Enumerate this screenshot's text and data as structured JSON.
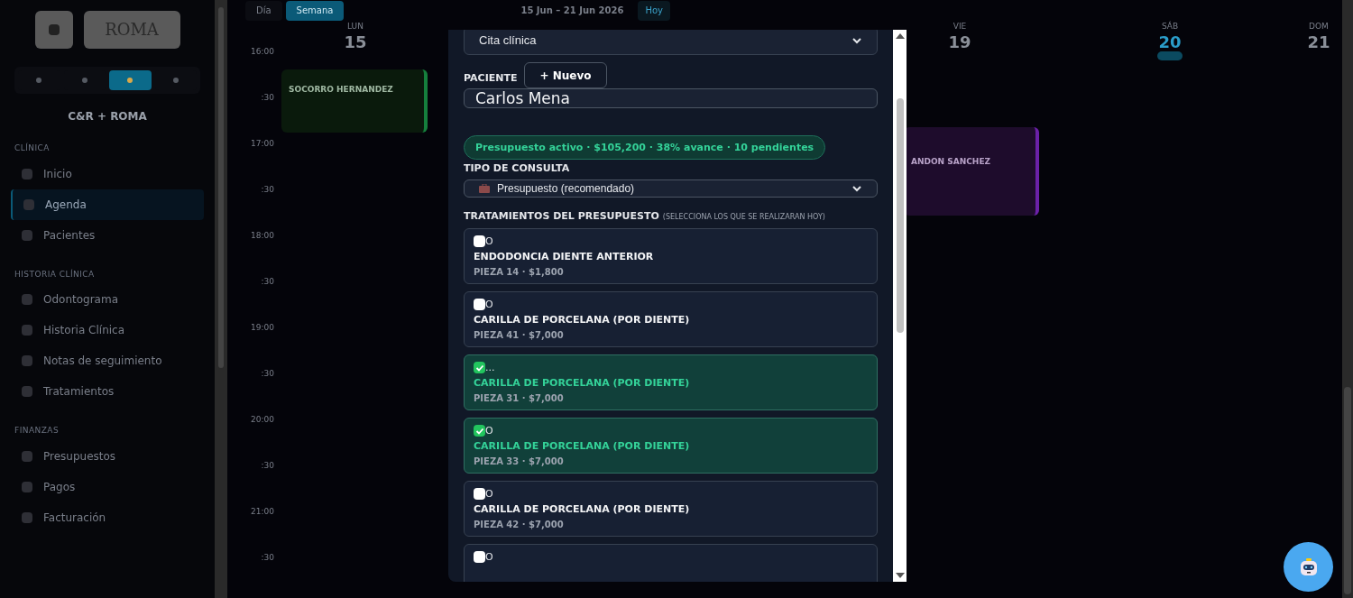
{
  "sidebar": {
    "brand": "C&R + ROMA",
    "logo_text": "ROMA",
    "theme_modes": [
      {
        "selected": false
      },
      {
        "selected": false
      },
      {
        "selected": true
      },
      {
        "selected": false
      }
    ],
    "sections": [
      {
        "title": "CLÍNICA",
        "items": [
          {
            "label": "Inicio",
            "selected": false
          },
          {
            "label": "Agenda",
            "selected": true
          },
          {
            "label": "Pacientes",
            "selected": false
          }
        ]
      },
      {
        "title": "HISTORIA CLÍNICA",
        "items": [
          {
            "label": "Odontograma",
            "selected": false
          },
          {
            "label": "Historia Clínica",
            "selected": false
          },
          {
            "label": "Notas de seguimiento",
            "selected": false
          },
          {
            "label": "Tratamientos",
            "selected": false
          }
        ]
      },
      {
        "title": "FINANZAS",
        "items": [
          {
            "label": "Presupuestos",
            "selected": false
          },
          {
            "label": "Pagos",
            "selected": false
          },
          {
            "label": "Facturación",
            "selected": false
          }
        ]
      }
    ]
  },
  "toolbar": {
    "views": [
      {
        "label": "Día",
        "selected": false
      },
      {
        "label": "Semana",
        "selected": true
      }
    ],
    "range": "15 Jun – 21 Jun 2026",
    "today": "Hoy"
  },
  "calendar": {
    "days": [
      {
        "weekday": "LUN",
        "day": "15",
        "today": false
      },
      {
        "weekday": "VIE",
        "day": "19",
        "today": false
      },
      {
        "weekday": "SÁB",
        "day": "20",
        "today": true
      },
      {
        "weekday": "DOM",
        "day": "21",
        "today": false
      }
    ],
    "times": [
      "16:00",
      ":30",
      "17:00",
      ":30",
      "18:00",
      ":30",
      "19:00",
      ":30",
      "20:00",
      ":30",
      "21:00",
      ":30"
    ],
    "events": [
      {
        "name": "SOCORRO HERNANDEZ",
        "color": "#15803d"
      },
      {
        "name": "ANDON SANCHEZ",
        "color": "#6b21a8"
      }
    ]
  },
  "modal": {
    "select_top": "Cita clínica",
    "patient_label": "PACIENTE",
    "new_button": "+ Nuevo",
    "patient_value": "Carlos Mena",
    "budget_badge": "Presupuesto activo · $105,200 · 38% avance · 10 pendientes",
    "type_label": "TIPO DE CONSULTA",
    "type_value": "Presupuesto (recomendado)",
    "treatments_label": "TRATAMIENTOS DEL PRESUPUESTO",
    "treatments_hint": "(SELECCIONA LOS QUE SE REALIZARAN HOY)",
    "treatments": [
      {
        "mark": "O",
        "name": "ENDODONCIA DIENTE ANTERIOR",
        "detail": "PIEZA 14 · $1,800",
        "checked": false
      },
      {
        "mark": "O",
        "name": "CARILLA DE PORCELANA (POR DIENTE)",
        "detail": "PIEZA 41 · $7,000",
        "checked": false
      },
      {
        "mark": "...",
        "name": "CARILLA DE PORCELANA (POR DIENTE)",
        "detail": "PIEZA 31 · $7,000",
        "checked": true
      },
      {
        "mark": "O",
        "name": "CARILLA DE PORCELANA (POR DIENTE)",
        "detail": "PIEZA 33 · $7,000",
        "checked": true
      },
      {
        "mark": "O",
        "name": "CARILLA DE PORCELANA (POR DIENTE)",
        "detail": "PIEZA 42 · $7,000",
        "checked": false
      },
      {
        "mark": "O",
        "checked": false
      }
    ]
  }
}
